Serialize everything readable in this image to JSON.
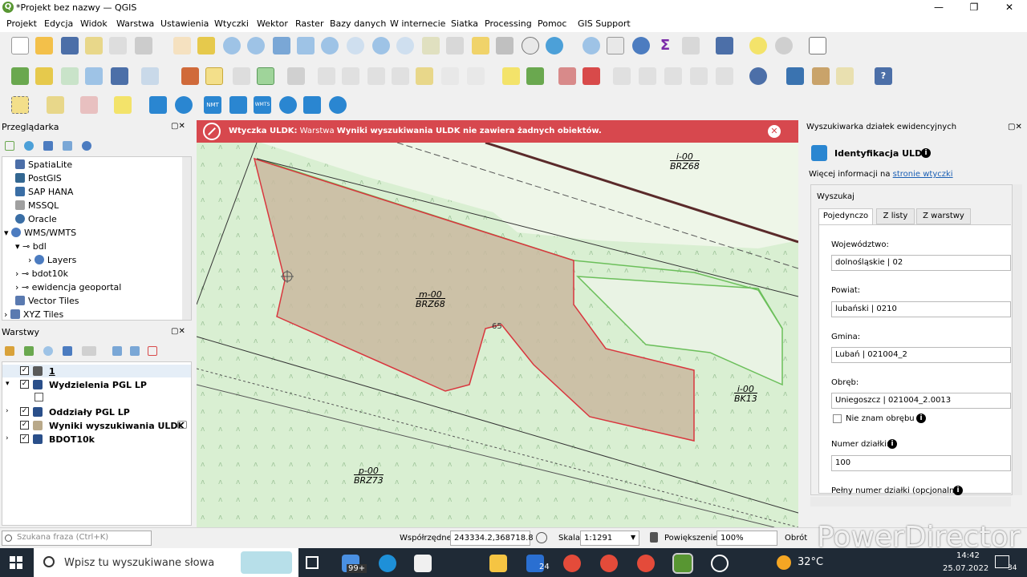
{
  "window": {
    "title": "*Projekt bez nazwy — QGIS",
    "minimize": "—",
    "restore": "❐",
    "close": "✕"
  },
  "menu": [
    "Projekt",
    "Edycja",
    "Widok",
    "Warstwa",
    "Ustawienia",
    "Wtyczki",
    "Wektor",
    "Raster",
    "Bazy danych",
    "W internecie",
    "Siatka",
    "Processing",
    "Pomoc",
    "GIS Support"
  ],
  "toolbar3_labels": {
    "nmt": "NMT",
    "wms": "WMTS"
  },
  "browser": {
    "title": "Przeglądarka",
    "items": [
      "SpatiaLite",
      "PostGIS",
      "SAP HANA",
      "MSSQL",
      "Oracle",
      "WMS/WMTS",
      "bdl",
      "Layers",
      "bdot10k",
      "ewidencja geoportal",
      "Vector Tiles",
      "XYZ Tiles"
    ]
  },
  "layers": {
    "title": "Warstwy",
    "items": [
      "1",
      "Wydzielenia PGL LP",
      "Oddziały PGL LP",
      "Wyniki wyszukiwania ULDK",
      "BDOT10k"
    ]
  },
  "alert": {
    "plugin": "Wtyczka ULDK:",
    "text1": " Warstwa ",
    "layer": "Wyniki wyszukiwania ULDK",
    "text2": " nie zawiera żadnych obiektów."
  },
  "map_labels": [
    {
      "id": "i00a",
      "l1": "i-00",
      "l2": "BRZ68"
    },
    {
      "id": "m00",
      "l1": "m-00",
      "l2": "BRZ68"
    },
    {
      "id": "i00b",
      "l1": "i-00",
      "l2": "BK13"
    },
    {
      "id": "p00",
      "l1": "p-00",
      "l2": "BRZ73"
    }
  ],
  "map_point_label": "65",
  "rpanel": {
    "title": "Wyszukiwarka działek ewidencyjnych",
    "plugin_title": "Identyfikacja ULDK",
    "info_prefix": "Więcej informacji na ",
    "info_link": "stronie wtyczki",
    "search_group": "Wyszukaj",
    "tabs": [
      "Pojedynczo",
      "Z listy",
      "Z warstwy"
    ],
    "wojewodztwo_label": "Województwo:",
    "wojewodztwo": "dolnośląskie | 02",
    "powiat_label": "Powiat:",
    "powiat": "lubański | 0210",
    "gmina_label": "Gmina:",
    "gmina": "Lubań | 021004_2",
    "obreb_label": "Obręb:",
    "obreb": "Uniegoszcz | 021004_2.0013",
    "nie_znam": "Nie znam obrębu",
    "numer_label": "Numer działki:",
    "numer": "100",
    "pelny_label": "Pełny numer działki (opcjonalny)"
  },
  "status": {
    "search_placeholder": "Szukana fraza (Ctrl+K)",
    "coord_label": "Współrzędne",
    "coord": "243334.2,368718.8",
    "scale_label": "Skala",
    "scale": "1:1291",
    "zoom_label": "Powiększenie",
    "zoom": "100%",
    "rotation_label": "Obrót"
  },
  "taskbar": {
    "search": "Wpisz tu wyszukiwane słowa",
    "badge1": "99+",
    "badge2": "24",
    "temp": "32°C",
    "time": "14:42",
    "date": "25.07.2022",
    "notif": "34"
  },
  "watermark": "PowerDirector",
  "colors": {
    "alert": "#d7484e",
    "map_green": "#d9efd2",
    "parcel": "#c9b9a0",
    "parcel_border": "#d9363e",
    "taskbar": "#1f2a36"
  }
}
